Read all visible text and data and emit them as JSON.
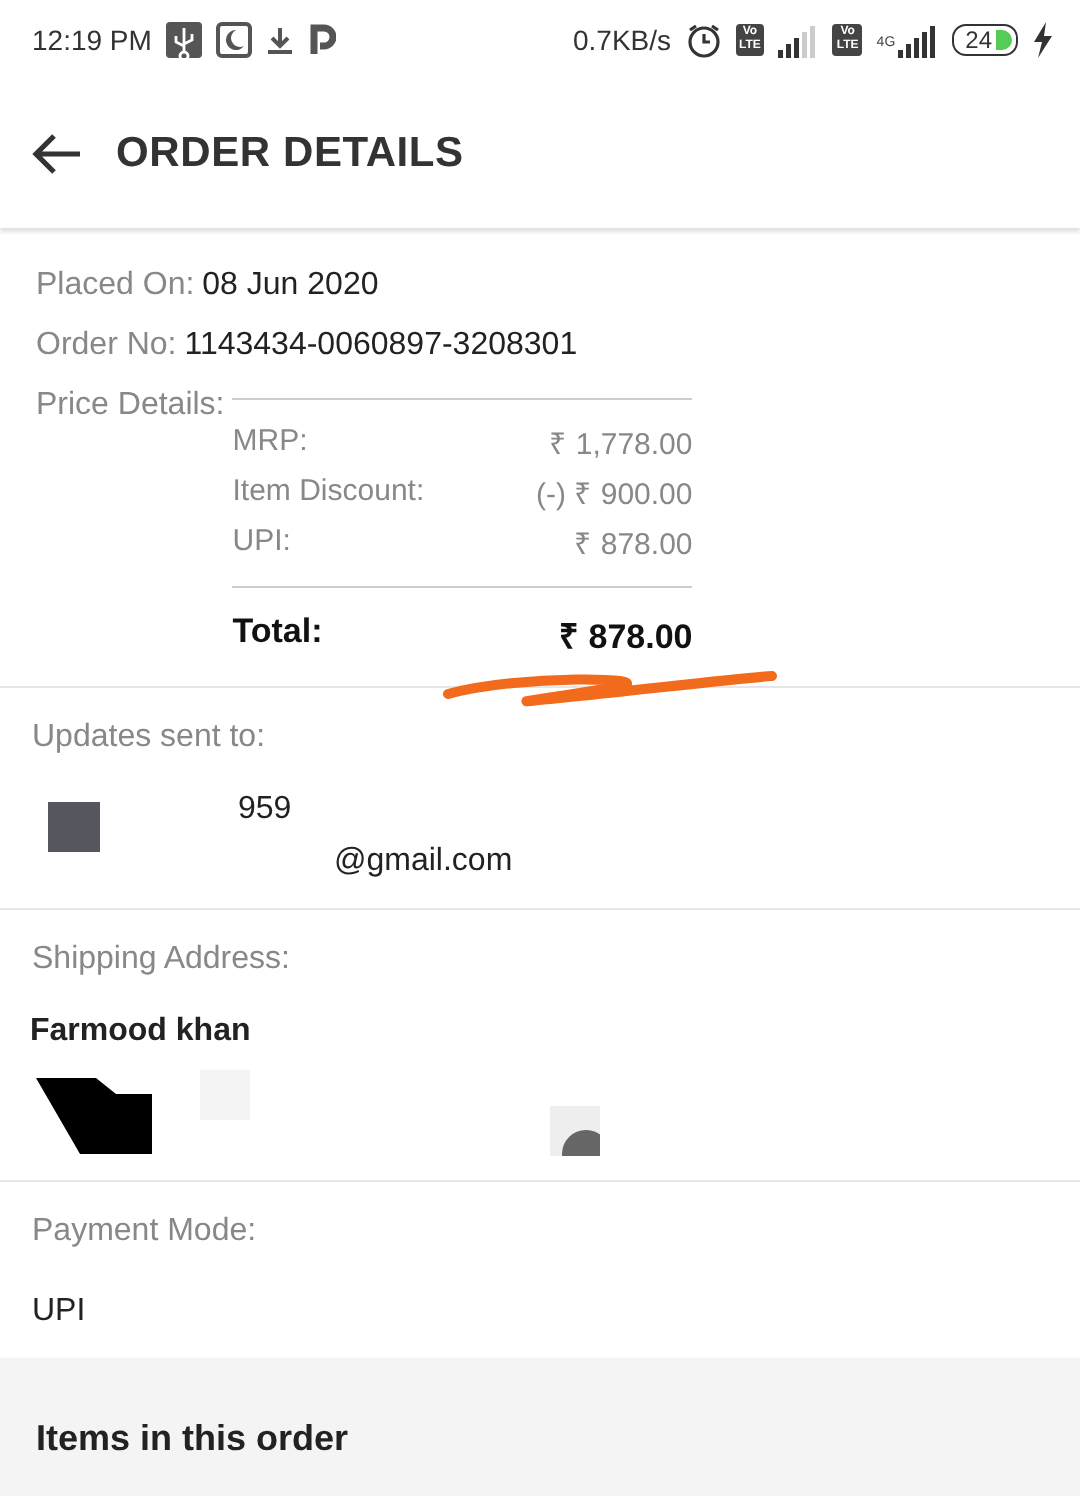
{
  "status_bar": {
    "time": "12:19 PM",
    "network_speed": "0.7KB/s",
    "sims": [
      {
        "badge_top": "Vo",
        "badge_bottom": "LTE"
      },
      {
        "badge_top": "Vo",
        "badge_bottom": "LTE",
        "network_type": "4G"
      }
    ],
    "battery": "24"
  },
  "header": {
    "title": "ORDER DETAILS"
  },
  "order_info": [
    {
      "label": "Placed On:",
      "value": "08 Jun 2020"
    },
    {
      "label": "Order No:",
      "value": "1143434-0060897-3208301"
    }
  ],
  "price_details": {
    "label": "Price Details:",
    "lines": [
      {
        "label": "MRP:",
        "amount": "₹ 1,778.00"
      },
      {
        "label": "Item Discount:",
        "amount": "(-) ₹ 900.00"
      },
      {
        "label": "UPI:",
        "amount": "₹ 878.00"
      }
    ],
    "total": {
      "label": "Total:",
      "amount": "₹ 878.00"
    }
  },
  "updates": {
    "label": "Updates sent to:",
    "phone": "959",
    "email": "@gmail.com"
  },
  "shipping": {
    "label": "Shipping Address:",
    "name": "Farmood khan"
  },
  "payment": {
    "label": "Payment Mode:",
    "value": "UPI"
  },
  "items_heading": "Items in this order"
}
